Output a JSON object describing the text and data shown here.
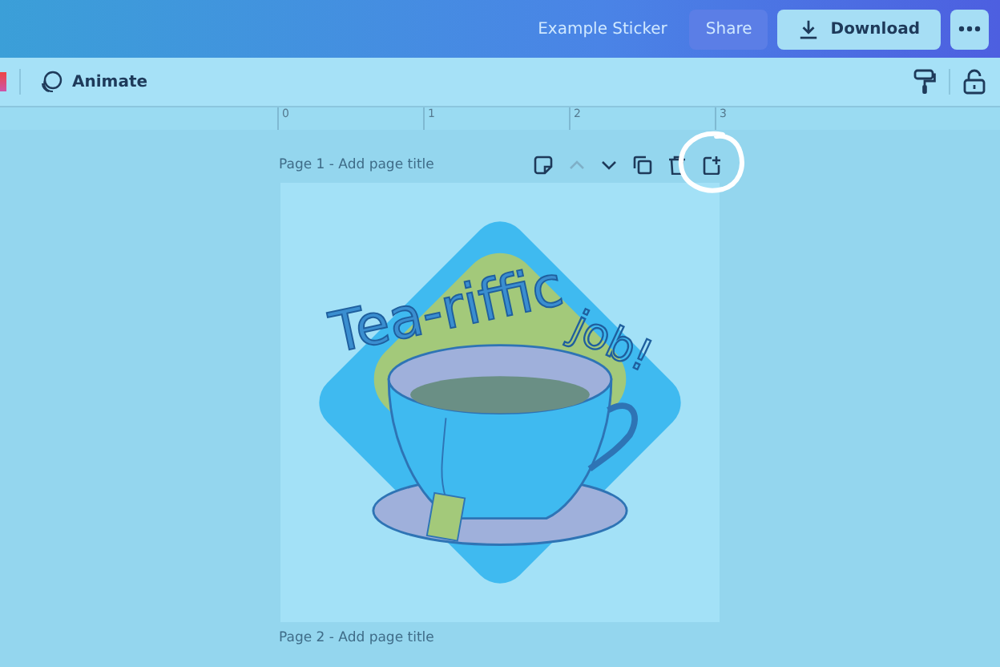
{
  "top_bar": {
    "design_title": "Example Sticker",
    "share_button": "Share",
    "download_button": "Download"
  },
  "toolbar": {
    "animate_button": "Animate"
  },
  "ruler": {
    "marks": [
      "0",
      "1",
      "2",
      "3"
    ]
  },
  "pages": [
    {
      "title": "Page 1 - Add page title",
      "actions": [
        {
          "kind": "note",
          "disabled": false
        },
        {
          "kind": "up",
          "disabled": true
        },
        {
          "kind": "down",
          "disabled": false
        },
        {
          "kind": "copy",
          "disabled": false
        },
        {
          "kind": "delete",
          "disabled": false
        },
        {
          "kind": "add",
          "disabled": false,
          "circled": true
        }
      ],
      "sticker": {
        "line_1": "Tea-riffic",
        "line_2": "job!"
      }
    },
    {
      "title": "Page 2 - Add page title"
    }
  ]
}
